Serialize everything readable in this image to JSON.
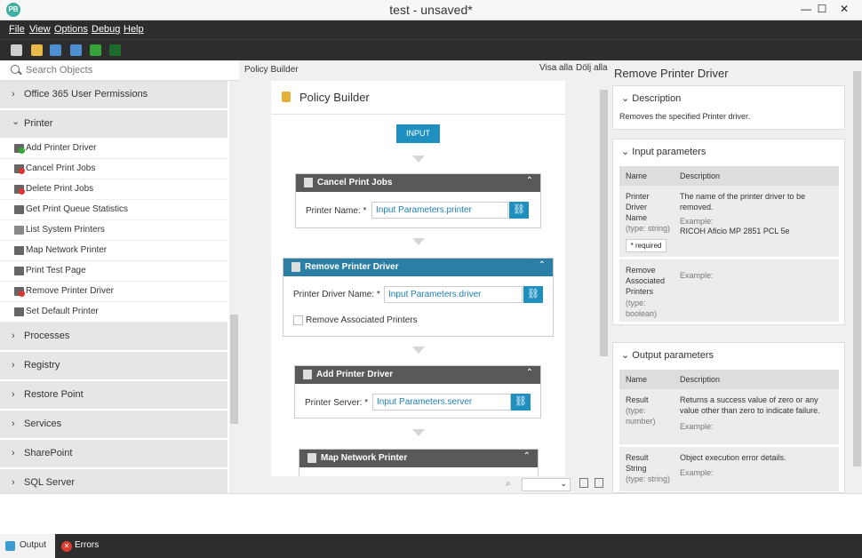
{
  "window": {
    "title": "test - unsaved*",
    "min": "—",
    "max": "☐",
    "close": "✕"
  },
  "menu": [
    "File",
    "View",
    "Options",
    "Debug",
    "Help"
  ],
  "left": {
    "search_placeholder": "Search Objects",
    "categories_top": [
      {
        "label": "Office 365 User Permissions",
        "chev": "›"
      },
      {
        "label": "Printer",
        "chev": "⌄"
      }
    ],
    "items": [
      {
        "label": "Add Printer Driver"
      },
      {
        "label": "Cancel Print Jobs"
      },
      {
        "label": "Delete Print Jobs"
      },
      {
        "label": "Get Print Queue Statistics"
      },
      {
        "label": "List System Printers"
      },
      {
        "label": "Map Network Printer"
      },
      {
        "label": "Print Test Page"
      },
      {
        "label": "Remove Printer Driver"
      },
      {
        "label": "Set Default Printer"
      }
    ],
    "categories_bottom": [
      {
        "label": "Processes"
      },
      {
        "label": "Registry"
      },
      {
        "label": "Restore Point"
      },
      {
        "label": "Services"
      },
      {
        "label": "SharePoint"
      },
      {
        "label": "SQL Server"
      }
    ]
  },
  "center": {
    "pane_label": "Policy Builder",
    "show_all": "Visa alla",
    "hide_all": "Dölj alla",
    "canvas_title": "Policy Builder",
    "input_button": "INPUT",
    "blocks": [
      {
        "title": "Cancel Print Jobs",
        "field_label": "Printer Name: *",
        "value": "Input Parameters.printer"
      },
      {
        "title": "Remove Printer Driver",
        "field_label": "Printer Driver Name: *",
        "value": "Input Parameters.driver",
        "checkbox_label": "Remove Associated Printers"
      },
      {
        "title": "Add Printer Driver",
        "field_label": "Printer Server: *",
        "value": "Input Parameters.server"
      },
      {
        "title": "Map Network Printer"
      }
    ]
  },
  "right": {
    "title": "Remove Printer Driver",
    "description": {
      "header": "Description",
      "text": "Removes the specified Printer driver."
    },
    "input_params": {
      "header": "Input parameters",
      "col_name": "Name",
      "col_desc": "Description",
      "rows": [
        {
          "name": "Printer Driver Name",
          "type": "(type: string)",
          "required": "* required",
          "desc": "The name of the printer driver to be removed.",
          "example_label": "Example:",
          "example": "RICOH Aficio MP 2851 PCL 5e"
        },
        {
          "name": "Remove Associated Printers",
          "type": "(type: boolean)",
          "desc": "",
          "example_label": "Example:",
          "example": ""
        }
      ]
    },
    "output_params": {
      "header": "Output parameters",
      "col_name": "Name",
      "col_desc": "Description",
      "rows": [
        {
          "name": "Result",
          "type": "(type: number)",
          "desc": "Returns a success value of zero or any value other than zero to indicate failure.",
          "example_label": "Example:"
        },
        {
          "name": "Result String",
          "type": "(type: string)",
          "desc": "Object execution error details.",
          "example_label": "Example:"
        }
      ]
    }
  },
  "status": {
    "output_tab": "Output",
    "errors_tab": "Errors"
  }
}
